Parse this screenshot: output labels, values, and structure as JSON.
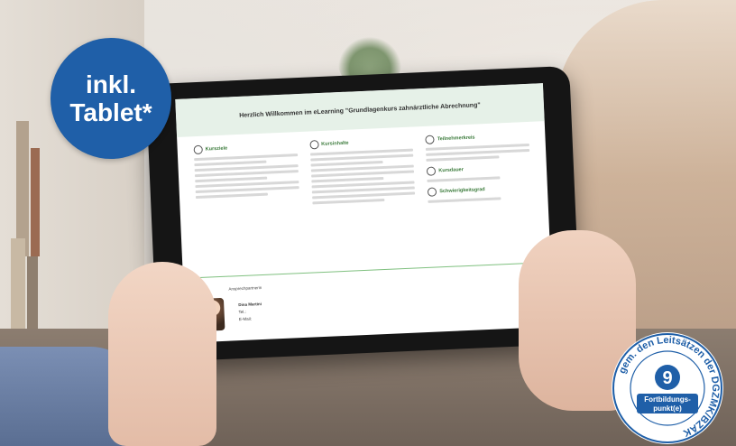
{
  "badge": {
    "line1": "inkl.",
    "line2": "Tablet*"
  },
  "seal": {
    "number": "9",
    "label_line1": "Fortbildungs-",
    "label_line2": "punkt(e)",
    "ring_text": "gem. den Leitsätzen der DGZMK/BZÄK",
    "color": "#1f5fa8"
  },
  "screen": {
    "heading": "Herzlich Willkommen im eLearning \"Grundlagenkurs zahnärztliche Abrechnung\"",
    "col1_title": "Kursziele",
    "col2_title": "Kursinhalte",
    "col3_title": "Teilnehmerkreis",
    "col3_sub1": "Kursdauer",
    "col3_sub2": "Schwierigkeitsgrad",
    "contact_title": "Ansprechpartnerin",
    "contact_name": "Dina Martini",
    "contact_tel_label": "Tel.:",
    "contact_mail_label": "E-Mail:"
  },
  "colors": {
    "accent_green": "#3a7a3a",
    "badge_blue": "#1f5fa8"
  }
}
